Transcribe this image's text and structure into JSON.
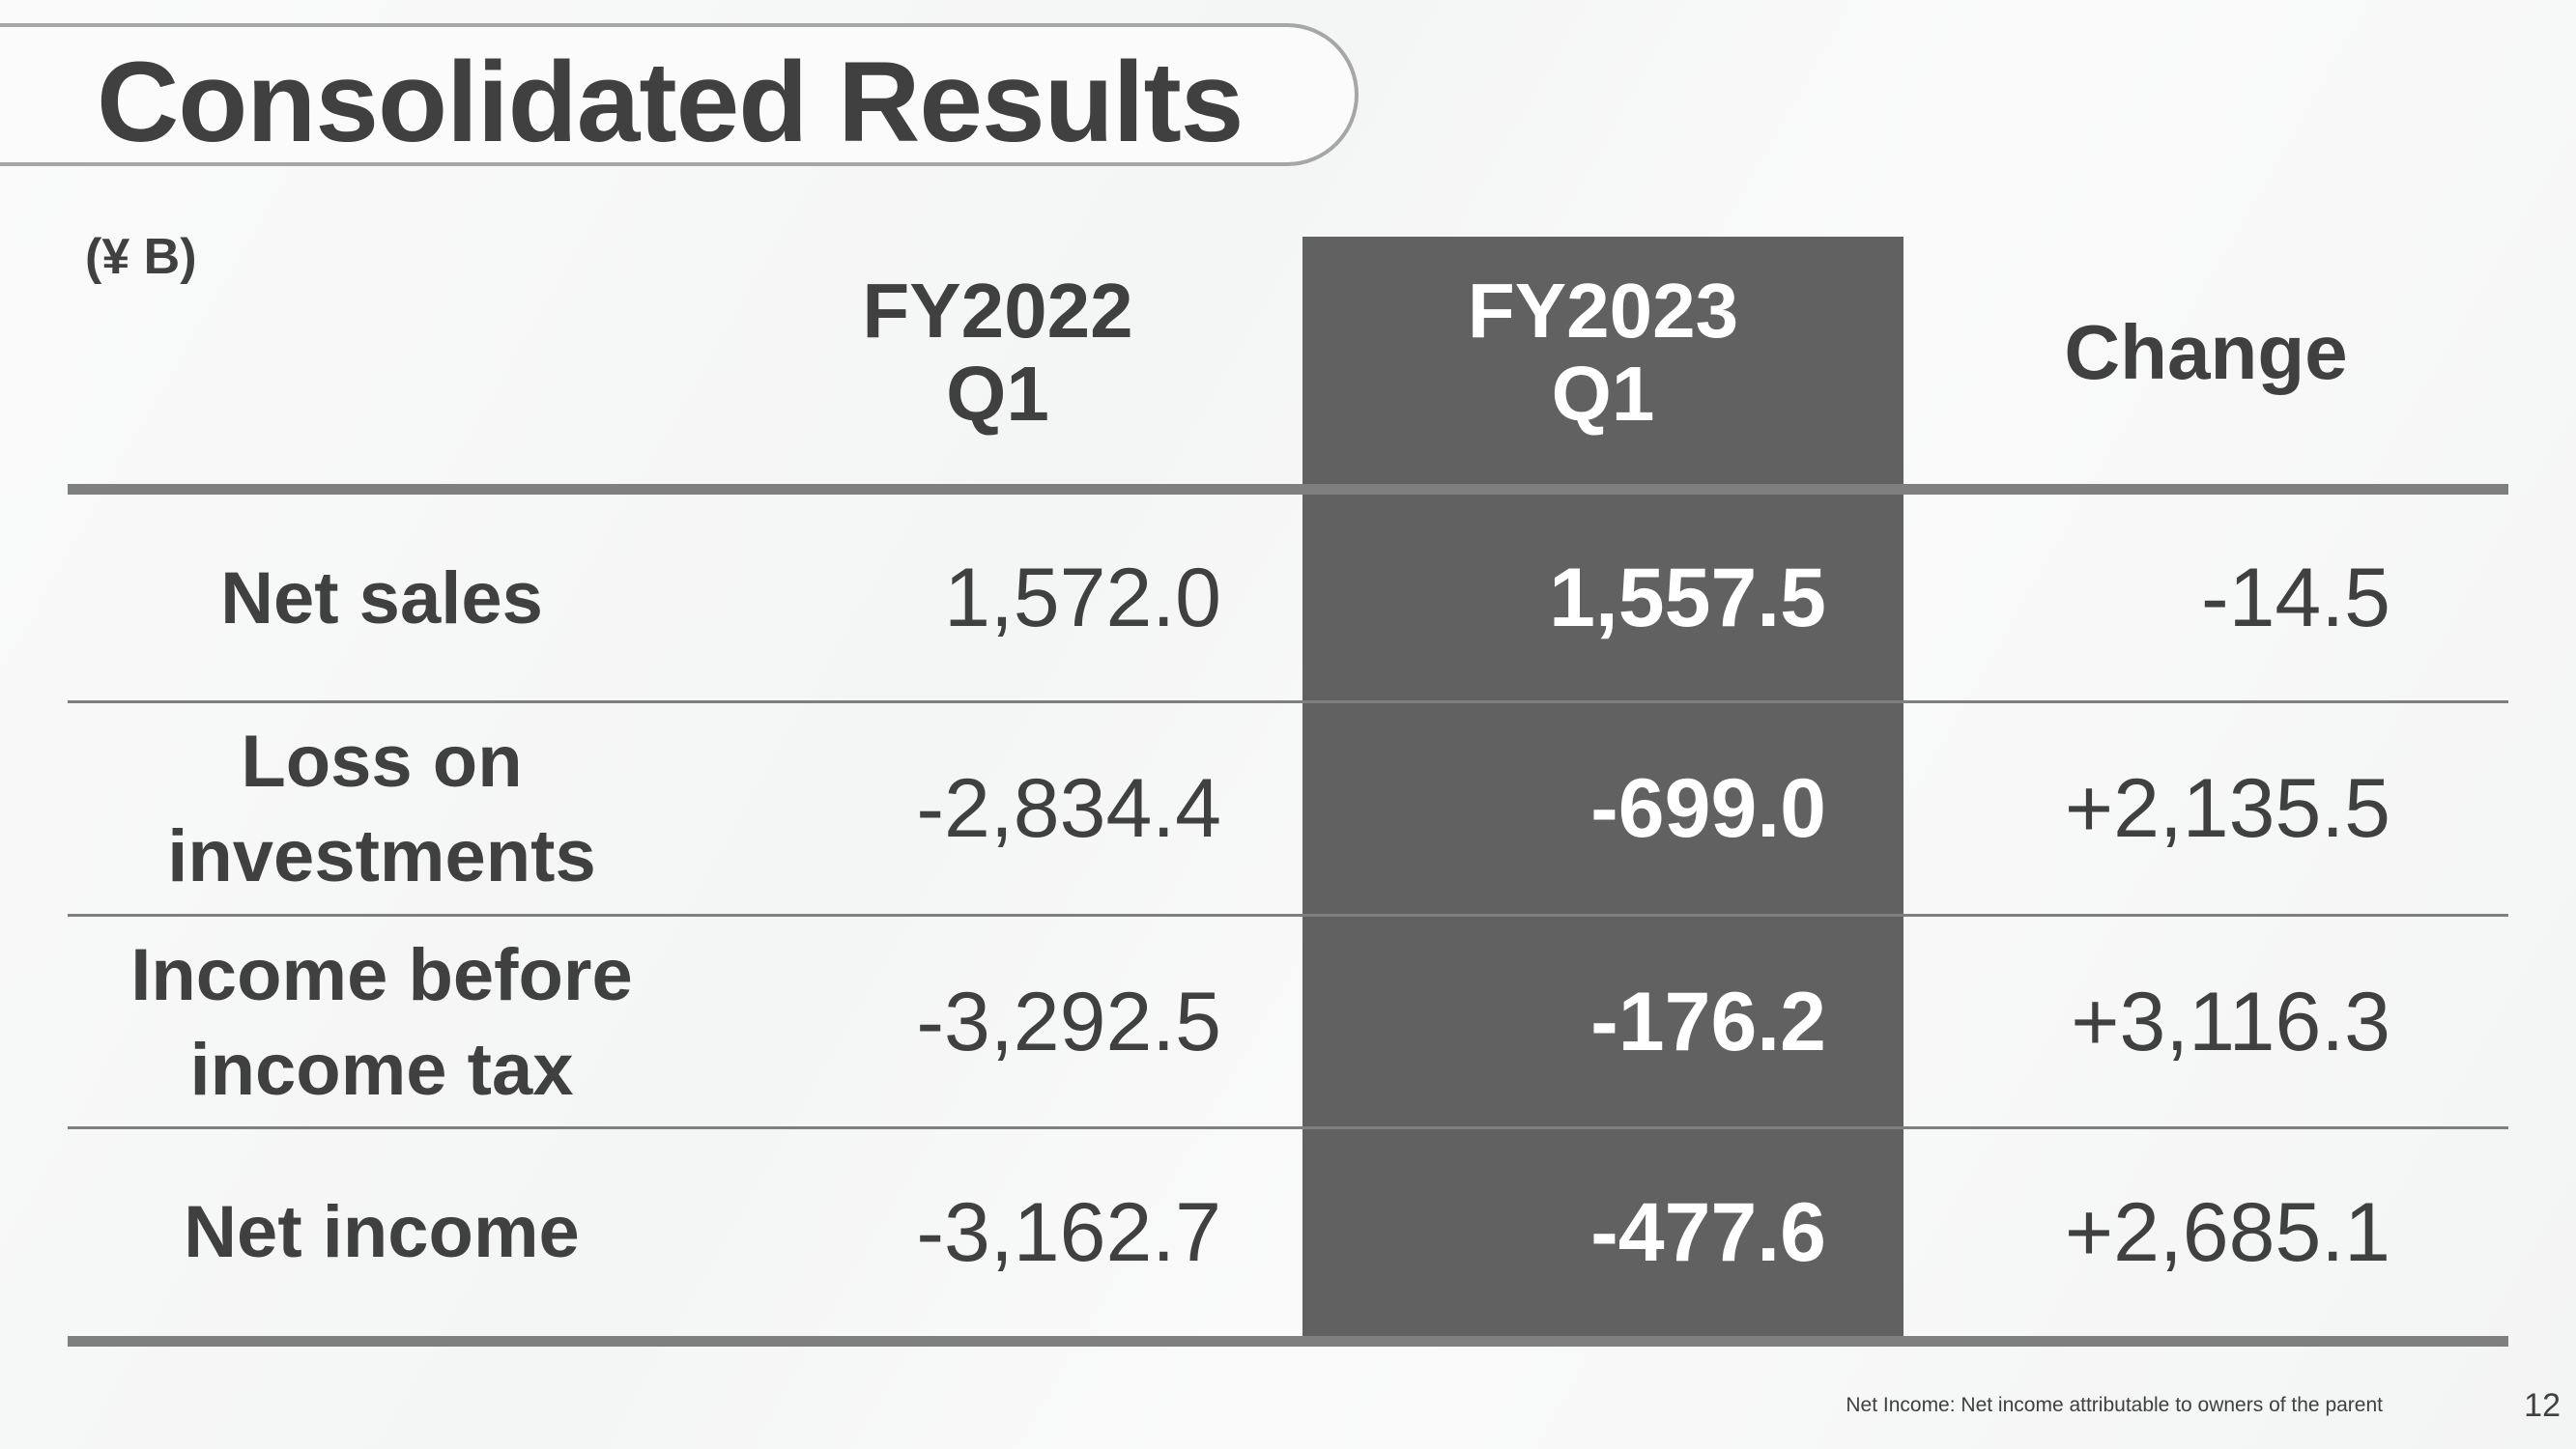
{
  "slide": {
    "title": "Consolidated Results",
    "unit": "(¥ B)",
    "page_number": "12",
    "footnote": "Net Income: Net income attributable to owners of the parent"
  },
  "table": {
    "columns": [
      {
        "line1": "FY2022",
        "line2": "Q1"
      },
      {
        "line1": "FY2023",
        "line2": "Q1",
        "highlighted": true
      },
      {
        "line1": "Change",
        "line2": ""
      }
    ],
    "rows": [
      {
        "label_line1": "Net sales",
        "label_line2": "",
        "fy2022_q1": "1,572.0",
        "fy2023_q1": "1,557.5",
        "change": "-14.5"
      },
      {
        "label_line1": "Loss on",
        "label_line2": "investments",
        "fy2022_q1": "-2,834.4",
        "fy2023_q1": "-699.0",
        "change": "+2,135.5"
      },
      {
        "label_line1": "Income before",
        "label_line2": "income tax",
        "fy2022_q1": "-3,292.5",
        "fy2023_q1": "-176.2",
        "change": "+3,116.3"
      },
      {
        "label_line1": "Net income",
        "label_line2": "",
        "fy2022_q1": "-3,162.7",
        "fy2023_q1": "-477.6",
        "change": "+2,685.1"
      }
    ]
  },
  "colors": {
    "text": "#404040",
    "highlight_column": "#616161",
    "rule": "#7f7f7f",
    "title_border": "#a6a6a6"
  }
}
